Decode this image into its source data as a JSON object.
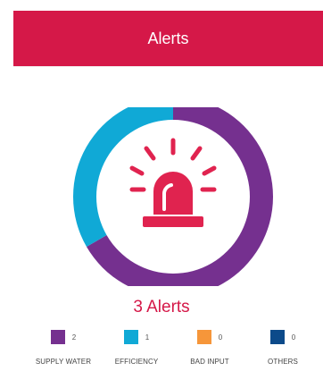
{
  "header": {
    "title": "Alerts"
  },
  "summary": {
    "count_label": "3 Alerts"
  },
  "colors": {
    "brand": "#d51848",
    "icon": "#e0234f",
    "supply_water": "#75308f",
    "efficiency": "#10a9d6",
    "bad_input": "#f6963a",
    "others": "#0c4a8a"
  },
  "icon": {
    "name": "alarm-siren-icon"
  },
  "legend": [
    {
      "label": "SUPPLY WATER",
      "value": "2",
      "color": "#75308f"
    },
    {
      "label": "EFFICIENCY",
      "value": "1",
      "color": "#10a9d6"
    },
    {
      "label": "BAD INPUT",
      "value": "0",
      "color": "#f6963a"
    },
    {
      "label": "OTHERS",
      "value": "0",
      "color": "#0c4a8a"
    }
  ],
  "chart_data": {
    "type": "pie",
    "categories": [
      "SUPPLY WATER",
      "EFFICIENCY",
      "BAD INPUT",
      "OTHERS"
    ],
    "values": [
      2,
      1,
      0,
      0
    ],
    "colors": [
      "#75308f",
      "#10a9d6",
      "#f6963a",
      "#0c4a8a"
    ],
    "title": "",
    "legend": "bottom"
  }
}
